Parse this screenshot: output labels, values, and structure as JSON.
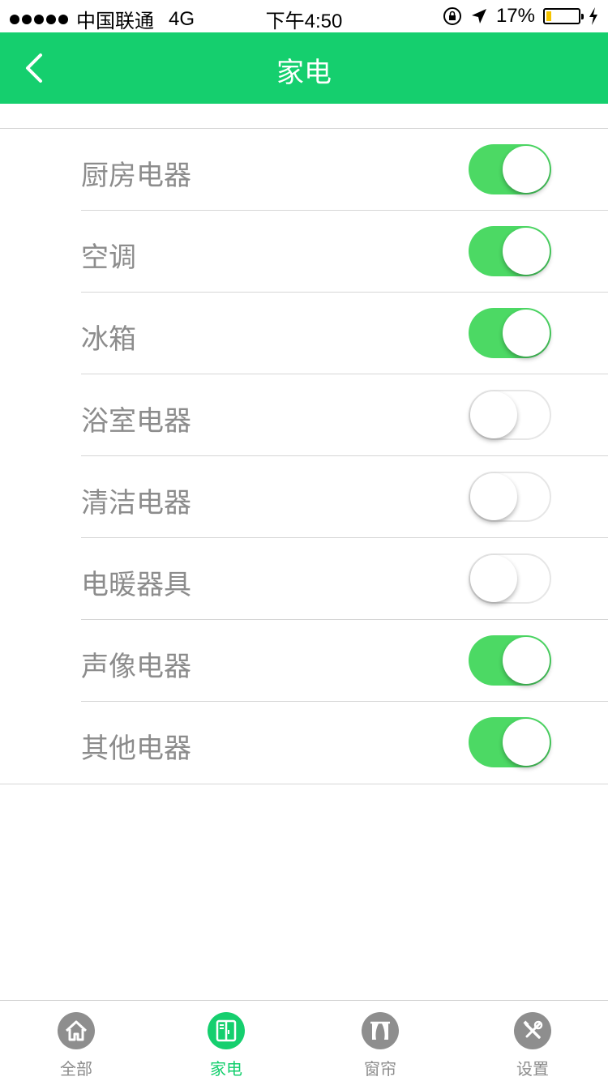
{
  "status_bar": {
    "carrier": "中国联通",
    "network": "4G",
    "time": "下午4:50",
    "battery_percent": "17%",
    "battery_level": 0.17
  },
  "nav": {
    "title": "家电",
    "back_icon": "chevron-left-icon"
  },
  "colors": {
    "brand": "#15cf6e",
    "switch_on": "#4cd964"
  },
  "appliances": [
    {
      "label": "厨房电器",
      "on": true
    },
    {
      "label": "空调",
      "on": true
    },
    {
      "label": "冰箱",
      "on": true
    },
    {
      "label": "浴室电器",
      "on": false
    },
    {
      "label": "清洁电器",
      "on": false
    },
    {
      "label": "电暖器具",
      "on": false
    },
    {
      "label": "声像电器",
      "on": true
    },
    {
      "label": "其他电器",
      "on": true
    }
  ],
  "tabs": [
    {
      "label": "全部",
      "icon": "home-icon",
      "active": false
    },
    {
      "label": "家电",
      "icon": "appliance-icon",
      "active": true
    },
    {
      "label": "窗帘",
      "icon": "curtain-icon",
      "active": false
    },
    {
      "label": "设置",
      "icon": "tools-icon",
      "active": false
    }
  ]
}
